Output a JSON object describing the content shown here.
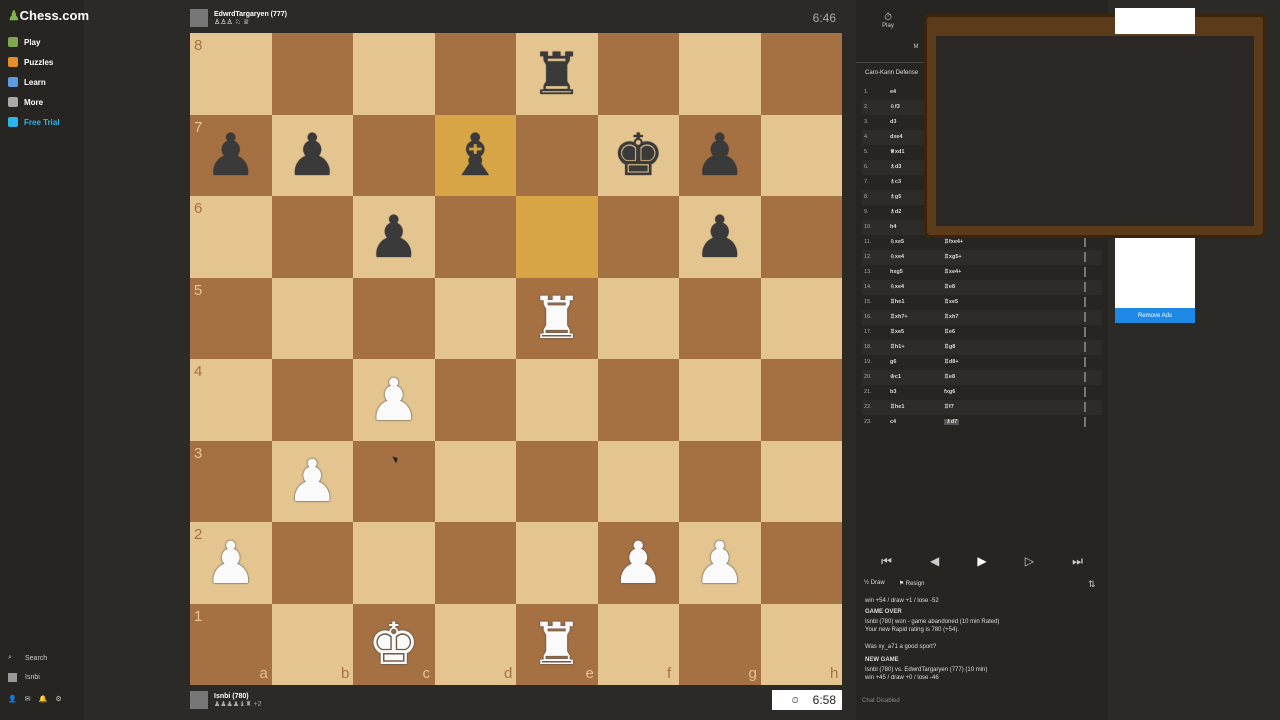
{
  "nav": {
    "logo": "Chess.com",
    "items": [
      {
        "label": "Play",
        "color": "#7fa650"
      },
      {
        "label": "Puzzles",
        "color": "#e58f2a"
      },
      {
        "label": "Learn",
        "color": "#5d9ce0"
      },
      {
        "label": "More",
        "color": "#aaaaaa"
      },
      {
        "label": "Free Trial",
        "color": "#2db4e8"
      }
    ],
    "search": "Search",
    "user": "Isnbi"
  },
  "top_player": {
    "name": "EdwrdTargaryen (777)",
    "captured": "♙♙♙ ♘ ♕",
    "clock": "6:46"
  },
  "bottom_player": {
    "name": "Isnbi (780)",
    "captured": "♟♟♟♟♝♜ +2",
    "clock": "6:58"
  },
  "board": {
    "files": [
      "a",
      "b",
      "c",
      "d",
      "e",
      "f",
      "g",
      "h"
    ],
    "ranks": [
      "8",
      "7",
      "6",
      "5",
      "4",
      "3",
      "2",
      "1"
    ],
    "highlight": [
      "d7",
      "e6"
    ],
    "pieces": [
      {
        "sq": "e8",
        "p": "♜",
        "c": "b"
      },
      {
        "sq": "a7",
        "p": "♟",
        "c": "b"
      },
      {
        "sq": "b7",
        "p": "♟",
        "c": "b"
      },
      {
        "sq": "d7",
        "p": "♝",
        "c": "b"
      },
      {
        "sq": "f7",
        "p": "♚",
        "c": "b"
      },
      {
        "sq": "g7",
        "p": "♟",
        "c": "b"
      },
      {
        "sq": "c6",
        "p": "♟",
        "c": "b"
      },
      {
        "sq": "g6",
        "p": "♟",
        "c": "b"
      },
      {
        "sq": "e5",
        "p": "♜",
        "c": "w"
      },
      {
        "sq": "c4",
        "p": "♟",
        "c": "w"
      },
      {
        "sq": "b3",
        "p": "♟",
        "c": "w"
      },
      {
        "sq": "a2",
        "p": "♟",
        "c": "w"
      },
      {
        "sq": "f2",
        "p": "♟",
        "c": "w"
      },
      {
        "sq": "g2",
        "p": "♟",
        "c": "w"
      },
      {
        "sq": "c1",
        "p": "♚",
        "c": "w"
      },
      {
        "sq": "e1",
        "p": "♜",
        "c": "w"
      }
    ]
  },
  "panel": {
    "tabs": [
      "Play",
      "M"
    ],
    "opening": "Caro-Kann Defense",
    "moves": [
      {
        "n": "1.",
        "w": "e4",
        "b": ""
      },
      {
        "n": "2.",
        "w": "♘f3",
        "b": ""
      },
      {
        "n": "3.",
        "w": "d3",
        "b": ""
      },
      {
        "n": "4.",
        "w": "dxe4",
        "b": ""
      },
      {
        "n": "5.",
        "w": "♕xd1",
        "b": ""
      },
      {
        "n": "6.",
        "w": "♗d3",
        "b": ""
      },
      {
        "n": "7.",
        "w": "♗c3",
        "b": ""
      },
      {
        "n": "8.",
        "w": "♗g5",
        "b": ""
      },
      {
        "n": "9.",
        "w": "♗d2",
        "b": ""
      },
      {
        "n": "10.",
        "w": "h4",
        "b": ""
      },
      {
        "n": "11.",
        "w": "♘xe5",
        "b": "♖fxe4+"
      },
      {
        "n": "12.",
        "w": "♘xe4",
        "b": "♖xg5+"
      },
      {
        "n": "13.",
        "w": "hxg5",
        "b": "♖xe4+"
      },
      {
        "n": "14.",
        "w": "♘xe4",
        "b": "♖e8"
      },
      {
        "n": "15.",
        "w": "♖he1",
        "b": "♖xe5"
      },
      {
        "n": "16.",
        "w": "♖xh7+",
        "b": "♖xh7"
      },
      {
        "n": "17.",
        "w": "♖xe5",
        "b": "♖e6"
      },
      {
        "n": "18.",
        "w": "♖h1+",
        "b": "♖g8"
      },
      {
        "n": "19.",
        "w": "g6",
        "b": "♖d8+"
      },
      {
        "n": "20.",
        "w": "♔c1",
        "b": "♖e8"
      },
      {
        "n": "21.",
        "w": "b3",
        "b": "fxg6"
      },
      {
        "n": "22.",
        "w": "♖he1",
        "b": "♖f7"
      },
      {
        "n": "23.",
        "w": "c4",
        "b": "♗d7"
      }
    ],
    "controls": [
      "⏮",
      "◀",
      "▶",
      "▷",
      "⏭"
    ],
    "draw": "Draw",
    "resign": "Resign",
    "chat": [
      {
        "t": "win +54 / draw +1 / lose -52",
        "b": false
      },
      {
        "t": "GAME OVER",
        "b": true
      },
      {
        "t": "Isnbi (780) won - game abandoned (10 min Rated)",
        "b": false
      },
      {
        "t": "Your new Rapid rating is 780 (+54).",
        "b": false
      },
      {
        "t": "Was xy_a71 a good sport?",
        "b": false
      },
      {
        "t": "NEW GAME",
        "b": true
      },
      {
        "t": "Isnbi (780) vs. EdwrdTargaryen (777) (10 min)",
        "b": false
      },
      {
        "t": "win +45 / draw +0 / lose -46",
        "b": false
      }
    ],
    "chat_disabled": "Chat Disabled"
  },
  "ads": {
    "remove": "Remove Ads"
  }
}
